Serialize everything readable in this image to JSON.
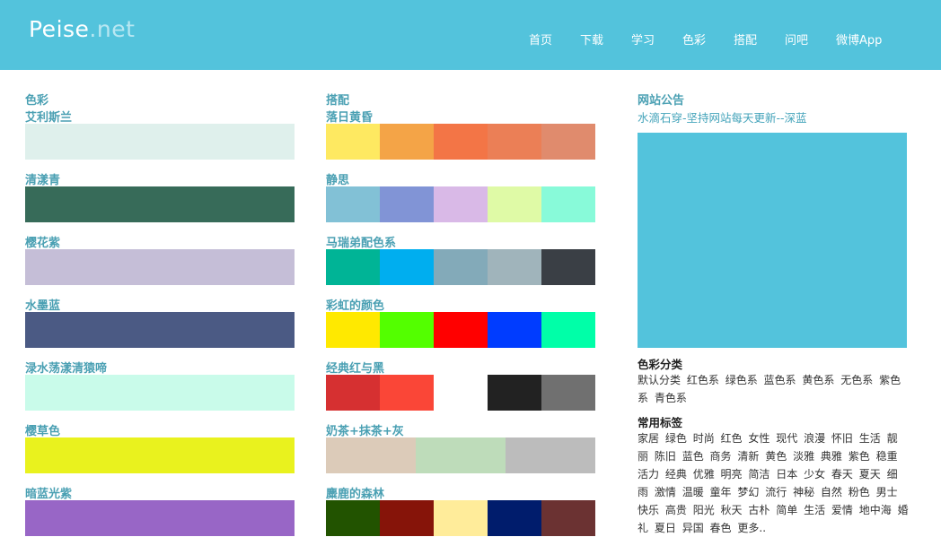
{
  "header": {
    "logo_main": "Peise",
    "logo_dot": ".",
    "logo_net": "net",
    "nav": [
      "首页",
      "下载",
      "学习",
      "色彩",
      "搭配",
      "问吧",
      "微博App"
    ],
    "bg_color": "#53c3dc"
  },
  "col1": {
    "title": "色彩",
    "items": [
      {
        "name": "艾利斯兰",
        "colors": [
          "#dff0ec"
        ]
      },
      {
        "name": "清漾青",
        "colors": [
          "#376b59"
        ]
      },
      {
        "name": "樱花紫",
        "colors": [
          "#c5bed7"
        ]
      },
      {
        "name": "水墨蓝",
        "colors": [
          "#4b5a84"
        ]
      },
      {
        "name": "渌水荡漾清猿啼",
        "colors": [
          "#c9fbea"
        ]
      },
      {
        "name": "樱草色",
        "colors": [
          "#e9f21e"
        ]
      },
      {
        "name": "暗蓝光紫",
        "colors": [
          "#9866c6"
        ]
      }
    ]
  },
  "col2": {
    "title": "搭配",
    "items": [
      {
        "name": "落日黄昏",
        "colors": [
          "#fee961",
          "#f4a447",
          "#f37546",
          "#eb7f56",
          "#e08b6d"
        ]
      },
      {
        "name": "静思",
        "colors": [
          "#82c1d6",
          "#8194d6",
          "#d9b9e7",
          "#dffaa6",
          "#88fad9"
        ]
      },
      {
        "name": "马瑞弟配色系",
        "colors": [
          "#00b496",
          "#00aeef",
          "#83aab9",
          "#a0b4bb",
          "#3a3f45"
        ]
      },
      {
        "name": "彩虹的颜色",
        "colors": [
          "#ffe900",
          "#53ff00",
          "#ff0000",
          "#003cff",
          "#00ffa8"
        ]
      },
      {
        "name": "经典红与黑",
        "colors": [
          "#d63031",
          "#fa4637",
          "#ffffff",
          "#222222",
          "#707070"
        ]
      },
      {
        "name": "奶茶+抹茶+灰",
        "colors": [
          "#dccbb9",
          "#bedcba",
          "#bcbcbc"
        ]
      },
      {
        "name": "麋鹿的森林",
        "colors": [
          "#225300",
          "#861409",
          "#ffec9a",
          "#001c6c",
          "#6b3232"
        ]
      }
    ]
  },
  "sidebar": {
    "notice_title": "网站公告",
    "notice_text": "水滴石穿-坚持网站每天更新--深蓝",
    "block_color": "#53c3dc",
    "category_title": "色彩分类",
    "categories": [
      "默认分类",
      "红色系",
      "绿色系",
      "蓝色系",
      "黄色系",
      "无色系",
      "紫色系",
      "青色系"
    ],
    "tags_title": "常用标签",
    "tags": [
      "家居",
      "绿色",
      "时尚",
      "红色",
      "女性",
      "现代",
      "浪漫",
      "怀旧",
      "生活",
      "靓丽",
      "陈旧",
      "蓝色",
      "商务",
      "清新",
      "黄色",
      "淡雅",
      "典雅",
      "紫色",
      "稳重",
      "活力",
      "经典",
      "优雅",
      "明亮",
      "简洁",
      "日本",
      "少女",
      "春天",
      "夏天",
      "细雨",
      "激情",
      "温暖",
      "童年",
      "梦幻",
      "流行",
      "神秘",
      "自然",
      "粉色",
      "男士",
      "快乐",
      "高贵",
      "阳光",
      "秋天",
      "古朴",
      "简单",
      "生活",
      "爱情",
      "地中海",
      "婚礼",
      "夏日",
      "异国",
      "春色",
      "更多.."
    ]
  }
}
